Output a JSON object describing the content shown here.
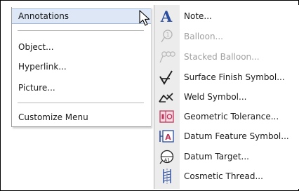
{
  "menu": {
    "items": [
      {
        "label": "Annotations"
      },
      {
        "label": "Object..."
      },
      {
        "label": "Hyperlink..."
      },
      {
        "label": "Picture..."
      },
      {
        "label": "Customize Menu"
      }
    ]
  },
  "submenu": {
    "items": [
      {
        "label": "Note...",
        "icon": "note-icon",
        "enabled": true
      },
      {
        "label": "Balloon...",
        "icon": "balloon-icon",
        "enabled": false
      },
      {
        "label": "Stacked Balloon...",
        "icon": "stacked-balloon-icon",
        "enabled": false
      },
      {
        "label": "Surface Finish Symbol...",
        "icon": "surface-finish-icon",
        "enabled": true
      },
      {
        "label": "Weld Symbol...",
        "icon": "weld-symbol-icon",
        "enabled": true
      },
      {
        "label": "Geometric Tolerance...",
        "icon": "geometric-tolerance-icon",
        "enabled": true
      },
      {
        "label": "Datum Feature Symbol...",
        "icon": "datum-feature-icon",
        "enabled": true
      },
      {
        "label": "Datum Target...",
        "icon": "datum-target-icon",
        "enabled": true
      },
      {
        "label": "Cosmetic Thread...",
        "icon": "cosmetic-thread-icon",
        "enabled": true
      }
    ]
  },
  "colors": {
    "highlight": "#dde7f6",
    "icon_blue": "#2b4ea0",
    "icon_red": "#c0365a",
    "disabled": "#a0a0a0"
  }
}
